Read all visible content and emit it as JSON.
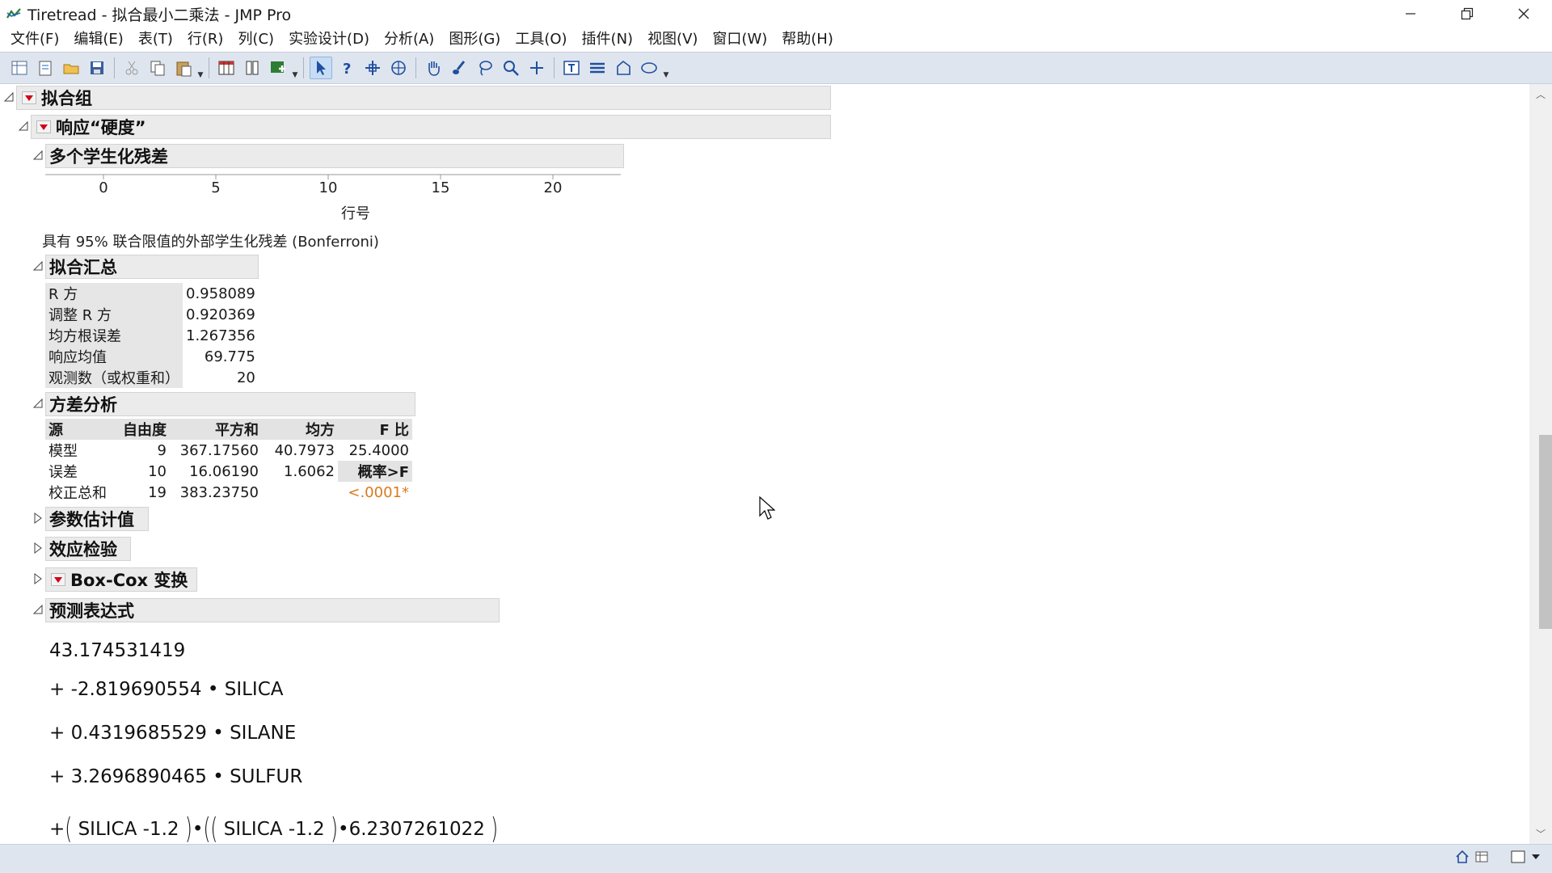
{
  "window": {
    "title": "Tiretread - 拟合最小二乘法 - JMP Pro"
  },
  "menu": [
    "文件(F)",
    "编辑(E)",
    "表(T)",
    "行(R)",
    "列(C)",
    "实验设计(D)",
    "分析(A)",
    "图形(G)",
    "工具(O)",
    "插件(N)",
    "视图(V)",
    "窗口(W)",
    "帮助(H)"
  ],
  "toolbar": {
    "icons": [
      "new-table-icon",
      "new-script-icon",
      "open-icon",
      "save-icon",
      "cut-icon",
      "copy-icon",
      "paste-icon",
      "data-table-icon",
      "column-icon",
      "add-rows-icon",
      "arrow-tool-icon",
      "help-tool-icon",
      "crosshair-icon",
      "selection-icon",
      "hand-icon",
      "brush-icon",
      "lasso-icon",
      "magnifier-icon",
      "plus-icon",
      "text-annotation-icon",
      "line-icon",
      "polygon-icon",
      "ellipse-icon"
    ],
    "active": "arrow-tool-icon"
  },
  "report": {
    "root_title": "拟合组",
    "response_title": "响应“硬度”",
    "residuals": {
      "title": "多个学生化残差",
      "ticks": [
        "0",
        "5",
        "10",
        "15",
        "20"
      ],
      "xlabel": "行号",
      "note": "具有 95% 联合限值的外部学生化残差 (Bonferroni)"
    },
    "summary": {
      "title": "拟合汇总",
      "rows": [
        {
          "label": "R 方",
          "value": "0.958089"
        },
        {
          "label": "调整 R 方",
          "value": "0.920369"
        },
        {
          "label": "均方根误差",
          "value": "1.267356"
        },
        {
          "label": "响应均值",
          "value": "69.775"
        },
        {
          "label": "观测数（或权重和）",
          "value": "20"
        }
      ]
    },
    "anova": {
      "title": "方差分析",
      "headers": [
        "源",
        "自由度",
        "平方和",
        "均方",
        "F 比"
      ],
      "rows": [
        {
          "source": "模型",
          "df": "9",
          "ss": "367.17560",
          "ms": "40.7973",
          "f": "25.4000"
        },
        {
          "source": "误差",
          "df": "10",
          "ss": "16.06190",
          "ms": "1.6062",
          "f": "概率>F"
        },
        {
          "source": "校正总和",
          "df": "19",
          "ss": "383.23750",
          "ms": "",
          "f": "<.0001*"
        }
      ]
    },
    "collapsed": {
      "params": "参数估计值",
      "effects": "效应检验",
      "boxcox": "Box-Cox 变换"
    },
    "prediction": {
      "title": "预测表达式",
      "intercept": "43.174531419",
      "terms": [
        {
          "coef": "+ -2.819690554",
          "var": "SILICA"
        },
        {
          "coef": "+ 0.4319685529",
          "var": "SILANE"
        },
        {
          "coef": "+ 3.2696890465",
          "var": "SULFUR"
        }
      ],
      "quad": {
        "lead": "+",
        "var1": "SILICA",
        "c1": "-1.2",
        "var2": "SILICA",
        "c2": "-1.2",
        "coef": "6.2307261022"
      }
    }
  }
}
